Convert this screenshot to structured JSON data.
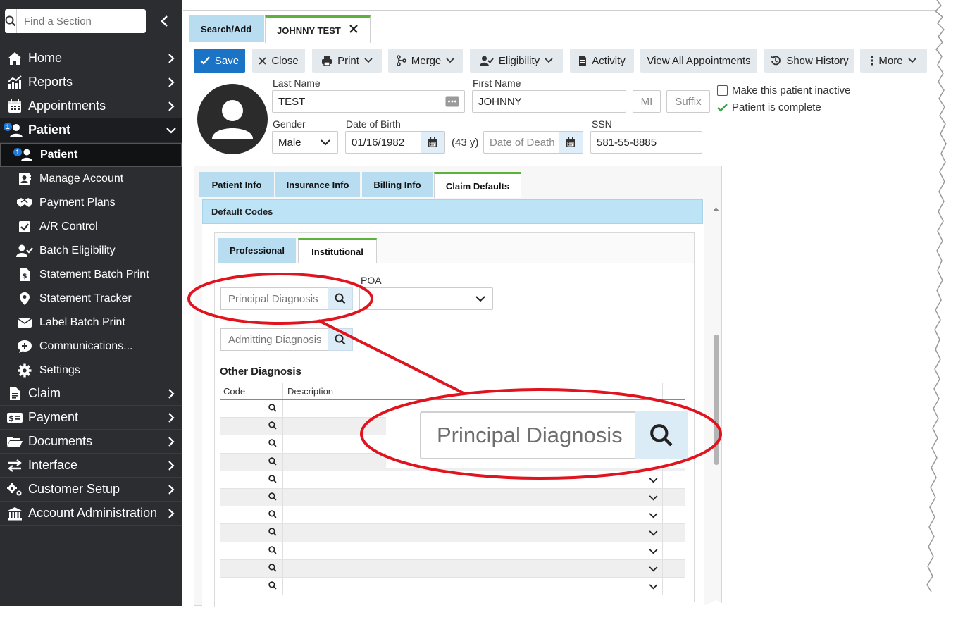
{
  "sidebar": {
    "search_placeholder": "Find a Section",
    "nav": [
      {
        "label": "Home",
        "icon": "home-icon"
      },
      {
        "label": "Reports",
        "icon": "reports-icon"
      },
      {
        "label": "Appointments",
        "icon": "calendar-icon"
      },
      {
        "label": "Patient",
        "icon": "patient-icon",
        "badge": "1"
      },
      {
        "label": "Claim",
        "icon": "claim-icon"
      },
      {
        "label": "Payment",
        "icon": "payment-icon"
      },
      {
        "label": "Documents",
        "icon": "folder-icon"
      },
      {
        "label": "Interface",
        "icon": "interface-icon"
      },
      {
        "label": "Customer Setup",
        "icon": "customer-setup-icon"
      },
      {
        "label": "Account Administration",
        "icon": "bank-icon"
      }
    ],
    "patient_sub": [
      {
        "label": "Patient",
        "icon": "patient-icon",
        "badge": "1"
      },
      {
        "label": "Manage Account",
        "icon": "manage-account-icon"
      },
      {
        "label": "Payment Plans",
        "icon": "handshake-icon"
      },
      {
        "label": "A/R Control",
        "icon": "checkbox-icon"
      },
      {
        "label": "Batch Eligibility",
        "icon": "user-check-icon"
      },
      {
        "label": "Statement Batch Print",
        "icon": "statement-icon"
      },
      {
        "label": "Statement Tracker",
        "icon": "map-pin-icon"
      },
      {
        "label": "Label Batch Print",
        "icon": "envelope-icon"
      },
      {
        "label": "Communications...",
        "icon": "chat-icon"
      },
      {
        "label": "Settings",
        "icon": "gear-icon"
      }
    ]
  },
  "tabs": {
    "search_add": "Search/Add",
    "patient_tab": "JOHNNY TEST"
  },
  "toolbar": {
    "save": "Save",
    "close": "Close",
    "print": "Print",
    "merge": "Merge",
    "eligibility": "Eligibility",
    "activity": "Activity",
    "view_all_appointments": "View All Appointments",
    "show_history": "Show History",
    "more": "More"
  },
  "patient": {
    "last_name_label": "Last Name",
    "last_name": "TEST",
    "first_name_label": "First Name",
    "first_name": "JOHNNY",
    "mi_placeholder": "MI",
    "suffix_placeholder": "Suffix",
    "gender_label": "Gender",
    "gender": "Male",
    "dob_label": "Date of Birth",
    "dob": "01/16/1982",
    "age": "(43 y)",
    "dod_placeholder": "Date of Death",
    "ssn_label": "SSN",
    "ssn": "581-55-8885",
    "inactive_label": "Make this patient inactive",
    "complete_label": "Patient is complete"
  },
  "panel_tabs": [
    "Patient Info",
    "Insurance Info",
    "Billing Info",
    "Claim Defaults"
  ],
  "default_codes": {
    "header": "Default Codes",
    "tabs": [
      "Professional",
      "Institutional"
    ],
    "principal_placeholder": "Principal Diagnosis",
    "poa_label": "POA",
    "poa_value": "",
    "admitting_placeholder": "Admitting Diagnosis",
    "other_title": "Other Diagnosis",
    "columns": [
      "Code",
      "Description",
      "",
      ""
    ],
    "row_count": 11
  },
  "callout": {
    "zoom_text": "Principal Diagnosis",
    "color": "#e0141e"
  }
}
